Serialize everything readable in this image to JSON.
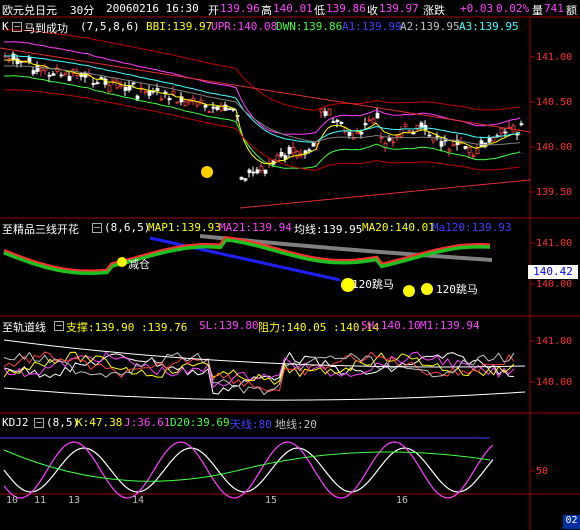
{
  "header": {
    "symbol": "欧元兑日元",
    "period": "30分",
    "date_time": "20060216 16:30",
    "open_label": "开",
    "open": "139.96",
    "high_label": "高",
    "high": "140.01",
    "low_label": "低",
    "low": "139.86",
    "close_label": "收",
    "close": "139.97",
    "change_label": "涨跌",
    "change": "+0.03",
    "change_pct": "0.02%",
    "volume_label": "量",
    "volume": "741",
    "amount_label": "额"
  },
  "panel1": {
    "prefix": "K",
    "name": "马到成功",
    "params": "(7,5,8,6)",
    "bbi": "BBI:139.97",
    "upr": "UPR:140.08",
    "dwn": "DWN:139.86",
    "a1": "A1:139.99",
    "a2": "A2:139.95",
    "a3": "A3:139.95",
    "ticks": [
      "141.00",
      "140.50",
      "140.00",
      "139.50"
    ]
  },
  "panel2": {
    "name": "至精品三线开花",
    "params": "(8,6,5)",
    "map1": "MAP1:139.93",
    "ma21": "MA21:139.94",
    "avg": "均线:139.95",
    "ma20": "MA20:140.01",
    "ma120": "Ma120:139.93",
    "ticks": [
      "141.00",
      "140.00"
    ],
    "current": "140.42",
    "signal_reduce": "减仓",
    "signal_jump1": "120跳马",
    "signal_jump2": "120跳马"
  },
  "panel3": {
    "name": "至轨道线",
    "support": "支撑:139.90 :139.76",
    "sl": "SL:139.80",
    "resistance": "阻力:140.05 :140.14",
    "sh": "SH:140.10",
    "m1": "M1:139.94",
    "ticks": [
      "141.00",
      "140.00"
    ]
  },
  "panel4": {
    "name": "KDJ2",
    "params": "(8,5)",
    "k": "K:47.38",
    "j": "J:36.61",
    "d20": "D20:39.69",
    "sky": "天线:80",
    "ground": "地线:20",
    "ticks": [
      "50"
    ]
  },
  "xaxis": {
    "labels": [
      "10",
      "11",
      "13",
      "14",
      "15",
      "16"
    ],
    "corner": "02"
  },
  "colors": {
    "axis_red": "#ff3030",
    "up": "#ff4040",
    "down": "#ffffff",
    "label_yellow": "#ffff00",
    "label_magenta": "#ff40ff",
    "label_green": "#40ff40",
    "label_cyan": "#40ffff"
  }
}
